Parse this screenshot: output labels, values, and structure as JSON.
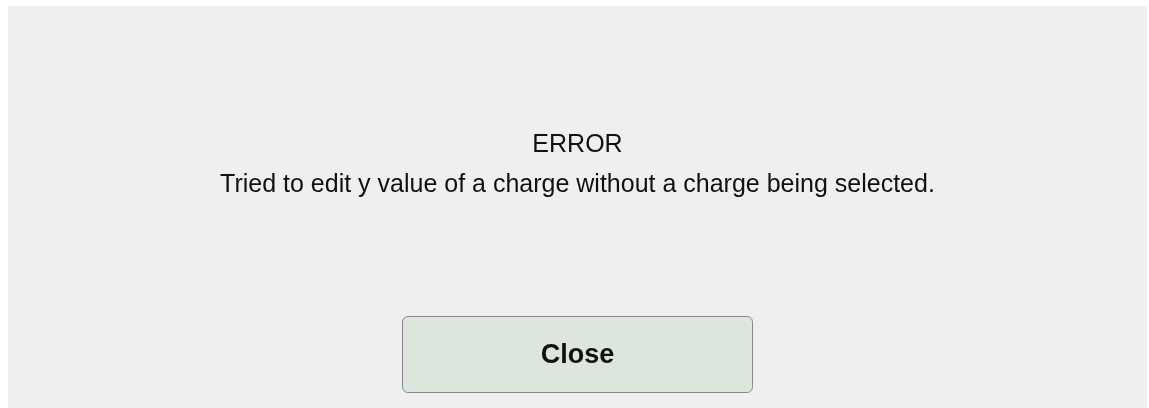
{
  "dialog": {
    "title": "ERROR",
    "message": "Tried to edit y value of a charge without a charge being selected.",
    "buttons": [
      {
        "label": "Close"
      }
    ]
  }
}
